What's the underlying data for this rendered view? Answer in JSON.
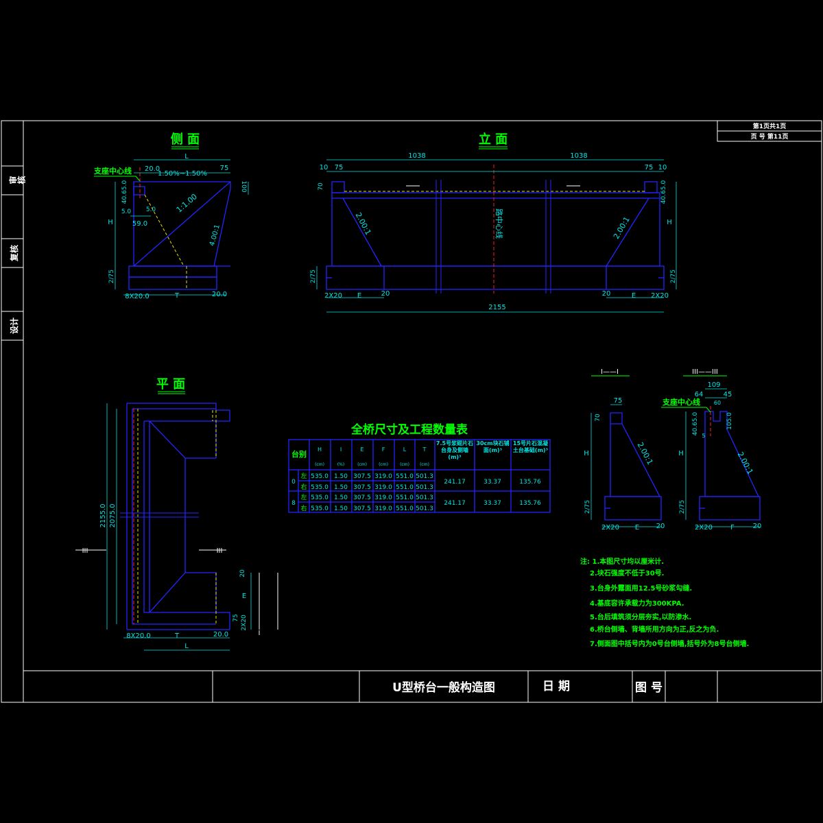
{
  "colors": {
    "background": "#000000",
    "frame": "#ffffff",
    "structure": "#2424ff",
    "dimension": "#00e5e5",
    "heading": "#00ff00",
    "centerline": "#ff2020",
    "hidden": "#e6e600"
  },
  "sheet_info": {
    "page_of": "第1页共1页",
    "page_no": "页 号 第11页"
  },
  "side_tabs": [
    "审核",
    "复核",
    "设计"
  ],
  "side_view": {
    "title": "侧 面",
    "bearing_centerline": "支座中心线",
    "dims": {
      "L": "L",
      "d20": "20.0",
      "slope": "1.50%~1.50%",
      "d75": "75",
      "d100": "100",
      "d4065": "40.65.0",
      "d50a": "5.0",
      "d50b": "5.0",
      "d590": "59.0",
      "H": "H",
      "s1": "1:1.00",
      "s2": "4.00:1",
      "d275": "2/75",
      "base_left": "8X20.0",
      "T": "T",
      "base_right": "20.0"
    }
  },
  "elevation": {
    "title": "立 面",
    "dims": {
      "half_left": "1038",
      "half_right": "1038",
      "l10": "10",
      "l75": "75",
      "r75": "75",
      "r10": "10",
      "d70": "70",
      "d4065": "40.65.0",
      "H": "H",
      "s_left": "2.00:1",
      "s_right": "2.00:1",
      "road_center": "路中心线",
      "h275l": "2/75",
      "h275r": "2/75",
      "b_left": "2X20",
      "E_left": "E",
      "b20l": "20",
      "b20r": "20",
      "E_right": "E",
      "b_right": "2X20",
      "total": "2155"
    }
  },
  "plan_view": {
    "title": "平 面",
    "dims": {
      "d2155": "2155.0",
      "d2075": "2075.0",
      "sec3l": "III",
      "sec3r": "III",
      "d20": "20",
      "E": "E",
      "d75": "75",
      "d2x20": "2X20",
      "sec1a": "I",
      "sec1b": "I",
      "base_left": "8X20.0",
      "T": "T",
      "d200": "20.0",
      "L": "L"
    }
  },
  "table": {
    "title": "全桥尺寸及工程数量表",
    "headers": [
      "台别",
      "H",
      "I",
      "E",
      "F",
      "L",
      "T",
      "7.5号浆砌片石台身及侧墙(m)³",
      "30cm块石铺面(m)³",
      "15号片石混凝土台基础(m)³"
    ],
    "units": [
      "(cm)",
      "(%)",
      "(cm)",
      "(cm)",
      "(cm)",
      "(cm)"
    ],
    "rows": [
      {
        "id": "0",
        "sides": [
          "左",
          "右"
        ],
        "vals": [
          [
            "535.0",
            "1.50",
            "307.5",
            "319.0",
            "551.0",
            "501.3"
          ],
          [
            "535.0",
            "1.50",
            "307.5",
            "319.0",
            "551.0",
            "501.3"
          ]
        ],
        "q": [
          "241.17",
          "33.37",
          "135.76"
        ]
      },
      {
        "id": "8",
        "sides": [
          "左",
          "右"
        ],
        "vals": [
          [
            "535.0",
            "1.50",
            "307.5",
            "319.0",
            "551.0",
            "501.3"
          ],
          [
            "535.0",
            "1.50",
            "307.5",
            "319.0",
            "551.0",
            "501.3"
          ]
        ],
        "q": [
          "241.17",
          "33.37",
          "135.76"
        ]
      }
    ]
  },
  "section_1": {
    "title": "I——I",
    "dims": {
      "d75": "75",
      "d70": "70",
      "H": "H",
      "slope": "2.00:1",
      "d275": "2/75",
      "b_left": "2X20",
      "E": "E",
      "b_right": "20"
    }
  },
  "section_3": {
    "title": "III——III",
    "bearing_centerline": "支座中心线",
    "dims": {
      "d109": "109",
      "d64": "64",
      "d45": "45",
      "d60": "60",
      "d4065": "40.65.0",
      "d1050": "105.0",
      "d5": "5",
      "H": "H",
      "slope": "2.00:1",
      "d275": "2/75",
      "b_left": "2X20",
      "F": "F",
      "b_right": "20"
    }
  },
  "notes": [
    "注: 1.本图尺寸均以厘米计.",
    "2.块石强度不低于30号.",
    "3.台身外露面用12.5号砂浆勾缝.",
    "4.基底容许承载力为300KPA.",
    "5.台后填筑须分层夯实,以防渗水.",
    "6.桥台侧墙、背墙所用方向为正,反之为负.",
    "7.侧面图中括号内为0号台侧墙,括号外为8号台侧墙."
  ],
  "title_block": {
    "drawing_title": "U型桥台一般构造图",
    "date_label": "日 期",
    "drawing_no_label": "图 号"
  }
}
